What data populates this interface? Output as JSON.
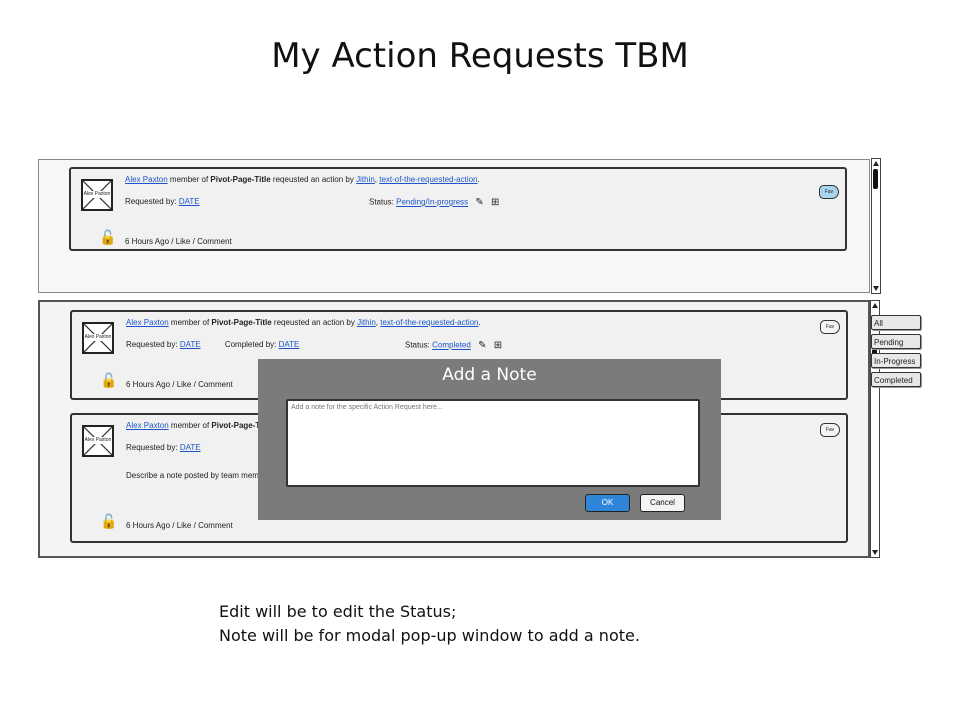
{
  "page": {
    "title": "My Action Requests TBM"
  },
  "common": {
    "avatar_caption": "Alex Paxton",
    "user": "Alex Paxton",
    "member_of": " member of ",
    "pivot": "Pivot-Page-Title",
    "requested_action_by": " reqeusted an action by ",
    "assignee": "Jithin",
    "comma": ", ",
    "action_text": "text-of-the-requested-action",
    "period": ".",
    "requested_by": "Requested by:",
    "date": "DATE",
    "completed_by": "Completed by:",
    "status": "Status:",
    "time_ago": "6 Hours Ago",
    "like": "Like",
    "comment": "Comment",
    "fav": "Fav",
    "sep": "  /  "
  },
  "top_card": {
    "status_value": "Pending/In-progress"
  },
  "card_one": {
    "status_value": "Completed"
  },
  "card_two": {
    "note_text": "Describe a note posted by team member"
  },
  "filters": {
    "items": [
      "All",
      "Pending",
      "In-Progress",
      "Completed"
    ]
  },
  "modal": {
    "title": "Add a Note",
    "placeholder": "Add a note for the specific Action Request here...",
    "ok_label": "OK",
    "cancel_label": "Cancel"
  },
  "notes": {
    "line1": "Edit will be to edit the Status;",
    "line2": "Note will be for modal pop-up window to add a note."
  },
  "icons": {
    "lock": "unlock-icon",
    "edit": "pencil-icon",
    "note": "add-note-icon"
  },
  "colors": {
    "link": "#1b55c9",
    "modal_bg": "#7b7b7b",
    "ok_button": "#2f86d9",
    "fav_active": "#a9d4ef"
  }
}
